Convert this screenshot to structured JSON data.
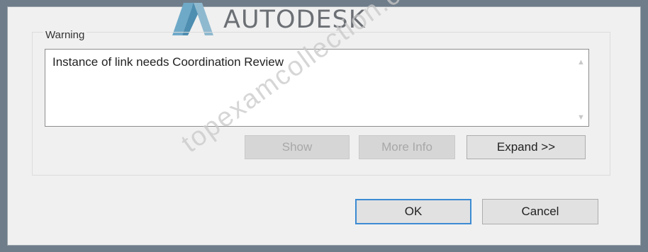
{
  "brand": {
    "name": "AUTODESK",
    "logo_icon": "autodesk-logo"
  },
  "warning": {
    "group_label": "Warning",
    "message": "Instance of link needs Coordination Review"
  },
  "actions": {
    "show_label": "Show",
    "more_info_label": "More Info",
    "expand_label": "Expand >>"
  },
  "footer": {
    "ok_label": "OK",
    "cancel_label": "Cancel"
  },
  "watermark": {
    "text": "topexamcollection.com"
  },
  "colors": {
    "frame": "#6f7d8a",
    "dialog": "#f0f0f0",
    "default_button_border": "#3c8bd3"
  }
}
